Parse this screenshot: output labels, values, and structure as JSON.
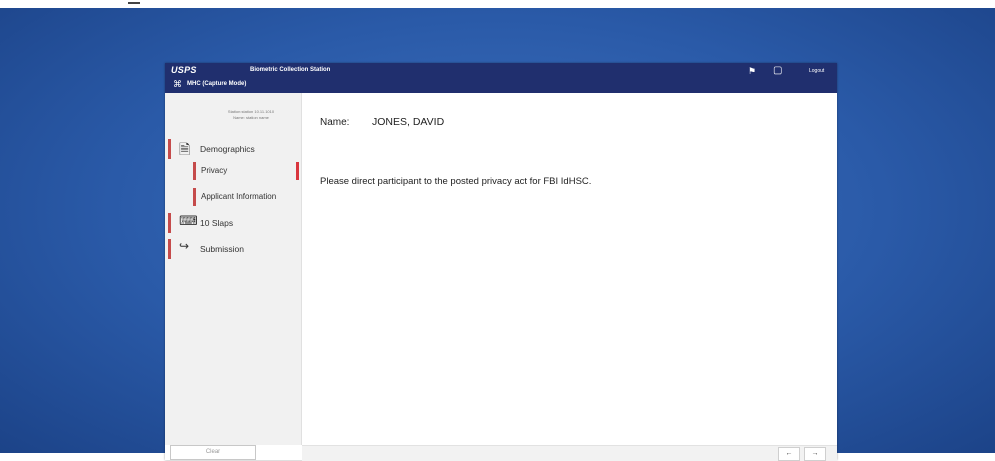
{
  "titlebar": {
    "logo": "USPS",
    "app_title": "Biometric Collection Station",
    "mode": "MHC (Capture Mode)",
    "logout": "Logout"
  },
  "sidebar": {
    "station_info": [
      "Station:station 10.11.1010",
      "Name: station name"
    ],
    "items": [
      {
        "label": "Demographics",
        "icon": "document-icon"
      },
      {
        "label": "10 Slaps",
        "icon": "fingerprint-scanner-icon"
      },
      {
        "label": "Submission",
        "icon": "export-icon"
      }
    ],
    "subitems": [
      {
        "label": "Privacy",
        "active": true
      },
      {
        "label": "Applicant Information",
        "active": false
      }
    ],
    "clear_label": "Clear"
  },
  "main": {
    "name_label": "Name:",
    "name_value": "JONES, DAVID",
    "message": "Please direct participant to the posted privacy act for FBI IdHSC."
  },
  "footer": {
    "back_label": "←",
    "next_label": "→"
  },
  "colors": {
    "titlebar": "#202f6e",
    "accent_bar": "#c54b4b",
    "active_bar": "#d9363e",
    "desktop": "#2a5aa8"
  }
}
